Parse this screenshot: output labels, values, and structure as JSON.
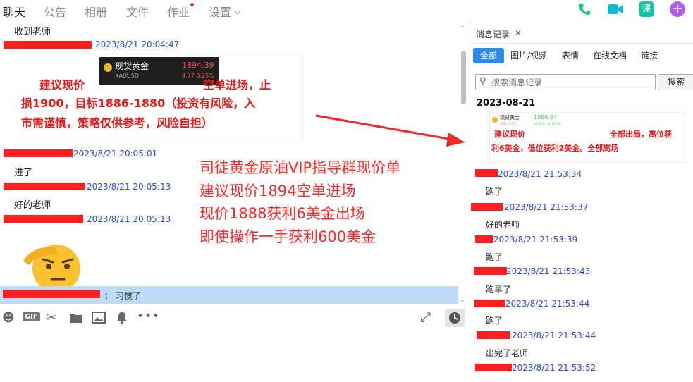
{
  "nav": {
    "tabs": [
      "聊天",
      "公告",
      "相册",
      "文件",
      "作业",
      "设置"
    ],
    "course_icon": "课",
    "plus_icon": "+"
  },
  "chat": {
    "msg1_text": "收到老师",
    "ts1": "2023/8/21 20:04:47",
    "card": {
      "ticker_name": "现货黄金",
      "ticker_symbol": "XAUUSD",
      "ticker_price": "1894.39",
      "ticker_change": "4.77  0.25%",
      "line1a": "建议现价",
      "line1b": "空单进场，止",
      "line2": "损1900，目标1886-1880（投资有风险，入",
      "line3": "市需谨慎，策略仅供参考，风险自担）"
    },
    "ts2": "2023/8/21 20:05:01",
    "msg2_text": "进了",
    "ts3": "2023/8/21 20:05:13",
    "msg3_text": "好的老师",
    "ts4": "2023/8/21 20:05:13",
    "overlay": [
      "司徒黄金原油VIP指导群现价单",
      "建议现价1894空单进场",
      "现价1888获利6美金出场",
      "即使操作一手获利600美金"
    ],
    "notice_text": "：  习惯了"
  },
  "right_panel": {
    "title": "消息记录",
    "close": "✕",
    "filters": [
      "全部",
      "图片/视频",
      "表情",
      "在线文档",
      "链接"
    ],
    "search_placeholder": "搜索消息记录",
    "search_button": "搜索",
    "date": "2023-08-21",
    "card": {
      "ticker_name": "现货黄金",
      "ticker_symbol": "XAUUSD",
      "ticker_price": "1886.97",
      "ticker_change": "-0.65  -0.03%",
      "line1a": "建议现价",
      "line1b": "全部出局，高位获",
      "line2": "利6美金，低位获利2美金。全部离场"
    },
    "messages": [
      {
        "ts": "2023/8/21 21:53:34",
        "text": "跑了"
      },
      {
        "ts": "2023/8/21 21:53:37",
        "text": "好的老师"
      },
      {
        "ts": "2023/8/21 21:53:39",
        "text": "跑了"
      },
      {
        "ts": "2023/8/21 21:53:43",
        "text": "跑早了"
      },
      {
        "ts": "2023/8/21 21:53:44",
        "text": "跑了"
      },
      {
        "ts": "2023/8/21 21:53:44",
        "text": "出完了老师"
      },
      {
        "ts": "2023/8/21 21:53:52",
        "text": ""
      }
    ]
  },
  "colors": {
    "accent": "#2e8ae6",
    "redact": "#ff1f1f",
    "timestamp": "#2a4bd9",
    "notice_bg": "#bddaf7"
  }
}
